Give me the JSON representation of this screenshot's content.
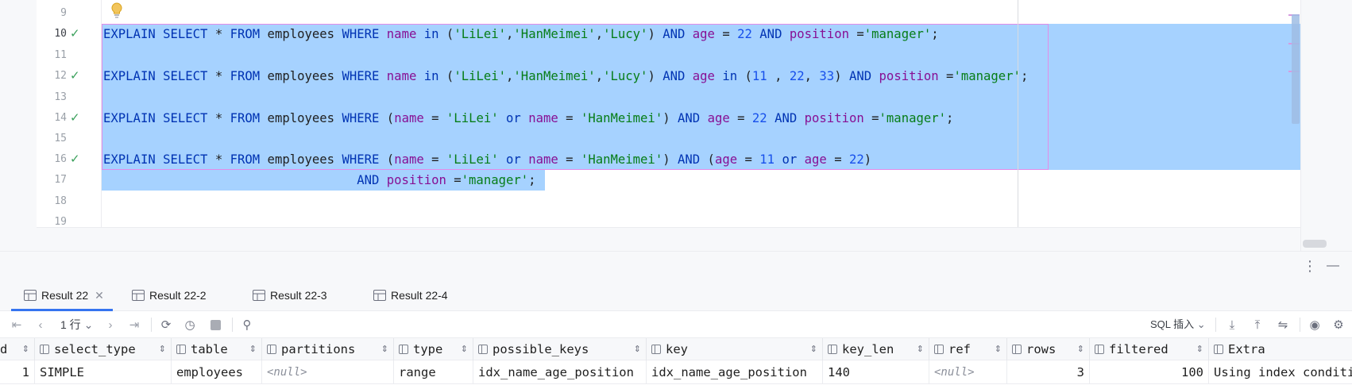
{
  "editor": {
    "line_numbers": [
      "9",
      "10",
      "11",
      "12",
      "13",
      "14",
      "15",
      "16",
      "17",
      "18",
      "19"
    ],
    "lines": {
      "l10": {
        "a": "EXPLAIN SELECT",
        "b": " * ",
        "c": "FROM",
        "d": " employees ",
        "e": "WHERE",
        "f": " ",
        "g": "name",
        "h": " ",
        "i": "in",
        "j": " (",
        "k": "'LiLei'",
        "l": ",",
        "m": "'HanMeimei'",
        "n": ",",
        "o": "'Lucy'",
        "p": ") ",
        "q": "AND",
        "r": " ",
        "s": "age",
        "t": " = ",
        "u": "22",
        "v": " ",
        "w": "AND",
        "x": " ",
        "y": "position",
        "z": " =",
        "aa": "'manager'",
        "ab": ";"
      },
      "l12": {
        "a": "EXPLAIN SELECT",
        "b": " * ",
        "c": "FROM",
        "d": " employees ",
        "e": "WHERE",
        "f": " ",
        "g": "name",
        "h": " ",
        "i": "in",
        "j": " (",
        "k": "'LiLei'",
        "l": ",",
        "m": "'HanMeimei'",
        "n": ",",
        "o": "'Lucy'",
        "p": ") ",
        "q": "AND",
        "r": " ",
        "s": "age",
        "t": " ",
        "u": "in",
        "v": " (",
        "w": "11",
        "x": " , ",
        "y": "22",
        "z": ", ",
        "aa": "33",
        "ab": ") ",
        "ac": "AND",
        "ad": " ",
        "ae": "position",
        "af": " =",
        "ag": "'manager'",
        "ah": ";"
      },
      "l14": {
        "a": "EXPLAIN SELECT",
        "b": " * ",
        "c": "FROM",
        "d": " employees ",
        "e": "WHERE",
        "f": " (",
        "g": "name",
        "h": " = ",
        "i": "'LiLei'",
        "j": " ",
        "k": "or",
        "l": " ",
        "m": "name",
        "n": " = ",
        "o": "'HanMeimei'",
        "p": ") ",
        "q": "AND",
        "r": " ",
        "s": "age",
        "t": " = ",
        "u": "22",
        "v": " ",
        "w": "AND",
        "x": " ",
        "y": "position",
        "z": " =",
        "aa": "'manager'",
        "ab": ";"
      },
      "l16": {
        "a": "EXPLAIN SELECT",
        "b": " * ",
        "c": "FROM",
        "d": " employees ",
        "e": "WHERE",
        "f": " (",
        "g": "name",
        "h": " = ",
        "i": "'LiLei'",
        "j": " ",
        "k": "or",
        "l": " ",
        "m": "name",
        "n": " = ",
        "o": "'HanMeimei'",
        "p": ") ",
        "q": "AND",
        "r": " (",
        "s": "age",
        "t": " = ",
        "u": "11",
        "v": " ",
        "w": "or",
        "x": " ",
        "y": "age",
        "z": " = ",
        "aa": "22",
        "ab": ")"
      },
      "l17": {
        "pad": "                                  ",
        "a": "AND",
        "b": " ",
        "c": "position",
        "d": " =",
        "e": "'manager'",
        "f": ";"
      }
    }
  },
  "tabs": [
    {
      "label": "Result 22",
      "close": "✕"
    },
    {
      "label": "Result 22-2"
    },
    {
      "label": "Result 22-3"
    },
    {
      "label": "Result 22-4"
    }
  ],
  "toolbar": {
    "rows_label": "1 行",
    "rows_chevron": "⌄",
    "sql_insert_label": "SQL 插入",
    "sql_insert_chevron": "⌄"
  },
  "grid": {
    "columns": [
      "d",
      "select_type",
      "table",
      "partitions",
      "type",
      "possible_keys",
      "key",
      "key_len",
      "ref",
      "rows",
      "filtered",
      "Extra"
    ],
    "row": [
      "1",
      "SIMPLE",
      "employees",
      "<null>",
      "range",
      "idx_name_age_position",
      "idx_name_age_position",
      "140",
      "<null>",
      "3",
      "100",
      "Using index conditi"
    ]
  },
  "colors": {
    "selection": "#a6d2ff",
    "keyword": "#0033b3",
    "column": "#871094",
    "string": "#067d17",
    "number": "#1750eb",
    "accent": "#3574f0",
    "check": "#3aa05b"
  },
  "icons": [
    "bulb-icon",
    "check-icon",
    "table-icon",
    "close-icon",
    "first-page-icon",
    "prev-page-icon",
    "next-page-icon",
    "last-page-icon",
    "refresh-icon",
    "history-icon",
    "stop-icon",
    "pin-icon",
    "download-icon",
    "upload-icon",
    "compare-icon",
    "eye-icon",
    "gear-icon",
    "more-icon",
    "minimize-icon"
  ]
}
